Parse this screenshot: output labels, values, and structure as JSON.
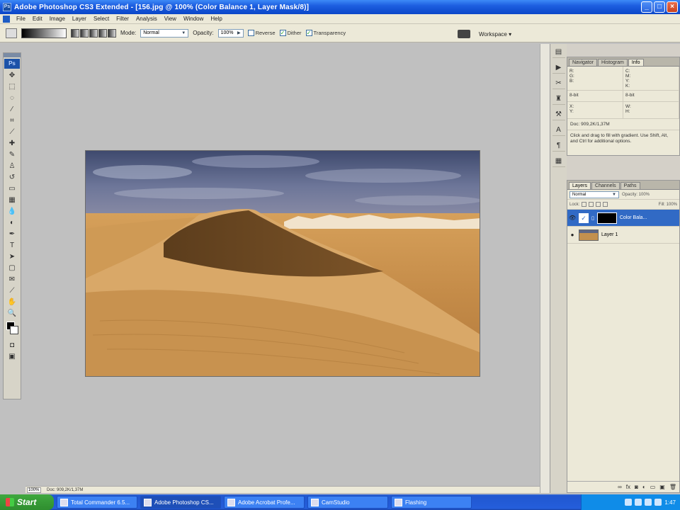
{
  "window": {
    "title": "Adobe Photoshop CS3 Extended - [156.jpg @ 100% (Color Balance 1, Layer Mask/8)]",
    "controls": [
      "_",
      "□",
      "×"
    ]
  },
  "menu": [
    "File",
    "Edit",
    "Image",
    "Layer",
    "Select",
    "Filter",
    "Analysis",
    "View",
    "Window",
    "Help"
  ],
  "options": {
    "mode_label": "Mode:",
    "mode_value": "Normal",
    "opacity_label": "Opacity:",
    "opacity_value": "100%",
    "reverse_label": "Reverse",
    "dither_label": "Dither",
    "transparency_label": "Transparency",
    "workspace_label": "Workspace ▾"
  },
  "tools": {
    "logo": "Ps"
  },
  "info_panel": {
    "tabs": [
      "Navigator",
      "Histogram",
      "Info"
    ],
    "active_tab": "Info",
    "rgb_label": "R:\nG:\nB:",
    "cmyk_label": "C:\nM:\nY:\nK:",
    "bit_left": "8-bit",
    "bit_right": "8-bit",
    "xy_label": "X:\nY:",
    "wh_label": "W:\nH:",
    "doc_size": "Doc: 909,2K/1,37M",
    "hint": "Click and drag to fill with gradient. Use Shift, Alt, and Ctrl for additional options."
  },
  "layers_panel": {
    "tabs": [
      "Layers",
      "Channels",
      "Paths"
    ],
    "active_tab": "Layers",
    "blend": "Normal",
    "opacity": "Opacity: 100%",
    "lock_label": "Lock:",
    "fill": "Fill: 100%",
    "layers": [
      {
        "name": "Color Bala...",
        "selected": true,
        "kind": "adjustment"
      },
      {
        "name": "Layer 1",
        "selected": false,
        "kind": "image"
      }
    ]
  },
  "status": {
    "zoom": "100%",
    "doc": "Doc: 909,2K/1,37M"
  },
  "taskbar": {
    "start": "Start",
    "tasks": [
      {
        "label": "Total Commander 6.5...",
        "active": false
      },
      {
        "label": "Adobe Photoshop CS...",
        "active": true
      },
      {
        "label": "Adobe Acrobat Profe...",
        "active": false
      },
      {
        "label": "CamStudio",
        "active": false
      },
      {
        "label": "Flashing",
        "active": false
      }
    ],
    "clock": "1:47"
  },
  "colors": {
    "title_bar": "#1d5ee0",
    "selected_layer": "#316ac5",
    "workspace_bg": "#c0c0c0",
    "panel_bg": "#ece9d8"
  }
}
